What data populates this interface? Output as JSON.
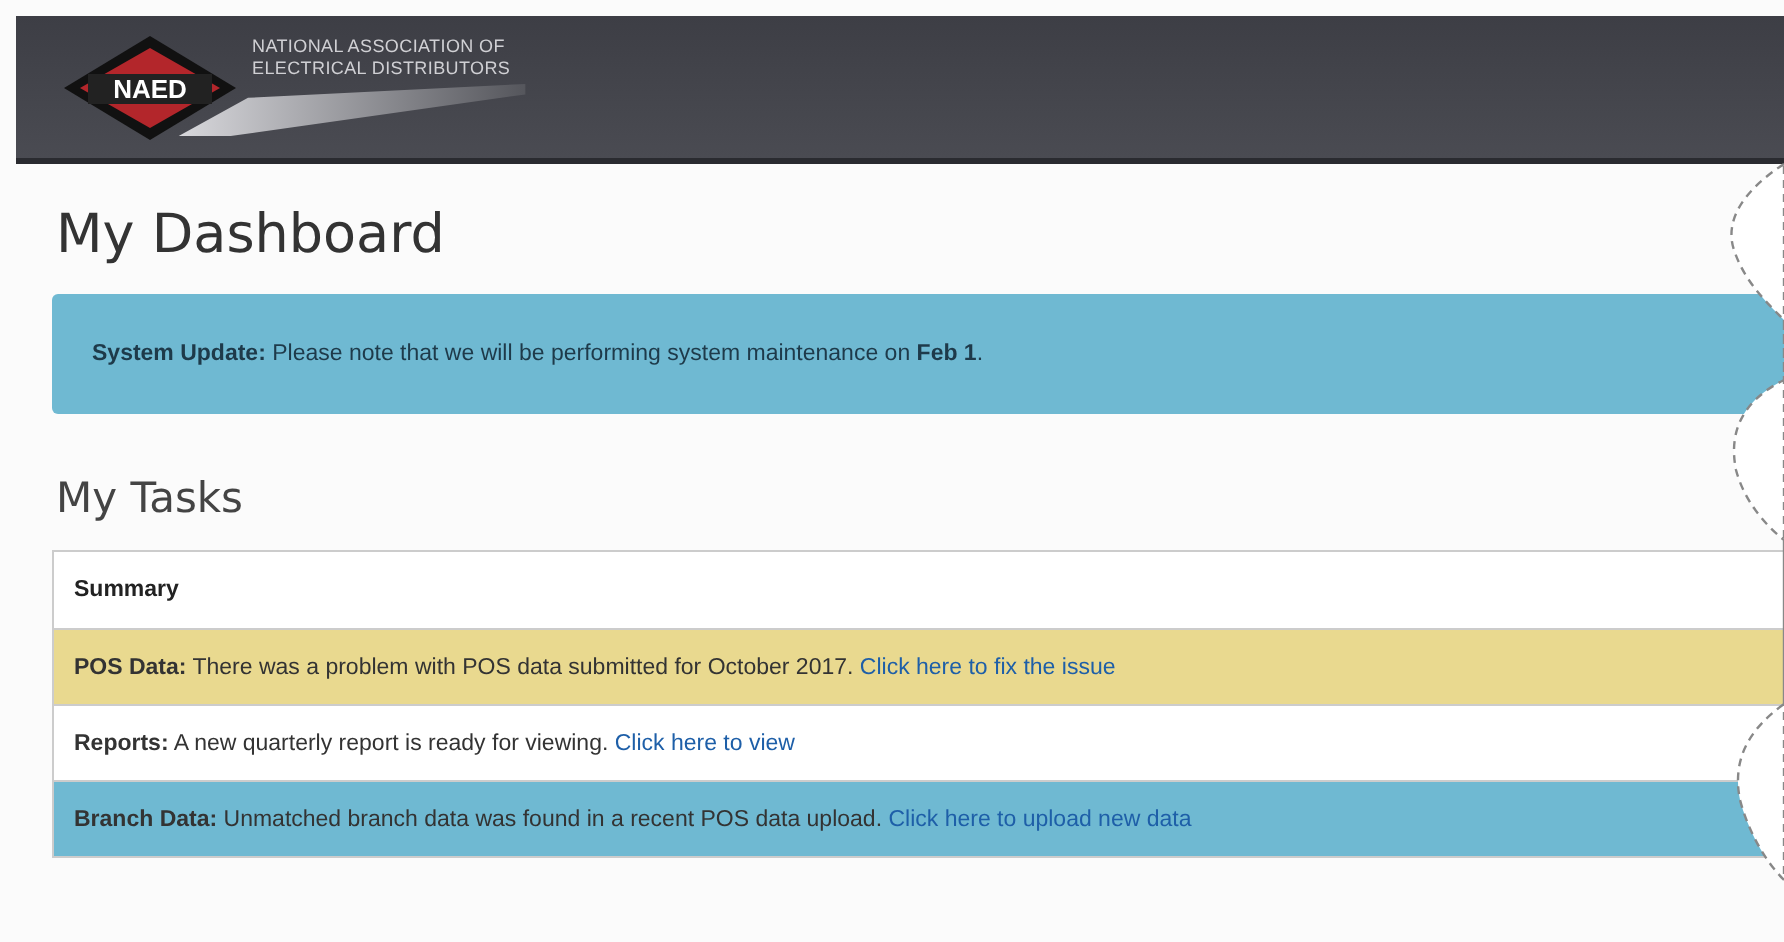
{
  "header": {
    "logo_text": "NAED",
    "org_name_line1": "NATIONAL ASSOCIATION OF",
    "org_name_line2": "ELECTRICAL DISTRIBUTORS"
  },
  "page_title": "My Dashboard",
  "alert": {
    "label": "System Update:",
    "text": "Please note that we will be performing system maintenance on **Feb 1**."
  },
  "tasks_title": "My Tasks",
  "tasks_table": {
    "header": "Summary",
    "rows": [
      {
        "kind": "warning",
        "label": "POS Data:",
        "text": "There was a problem with POS data submitted for October 2017.",
        "link": "Click here to fix the issue"
      },
      {
        "kind": "default",
        "label": "Reports:",
        "text": "A new quarterly report is ready for viewing.",
        "link": "Click here to view"
      },
      {
        "kind": "info",
        "label": "Branch Data:",
        "text": "Unmatched branch data was found in a recent POS data upload.",
        "link": "Click here to upload new data"
      }
    ]
  }
}
